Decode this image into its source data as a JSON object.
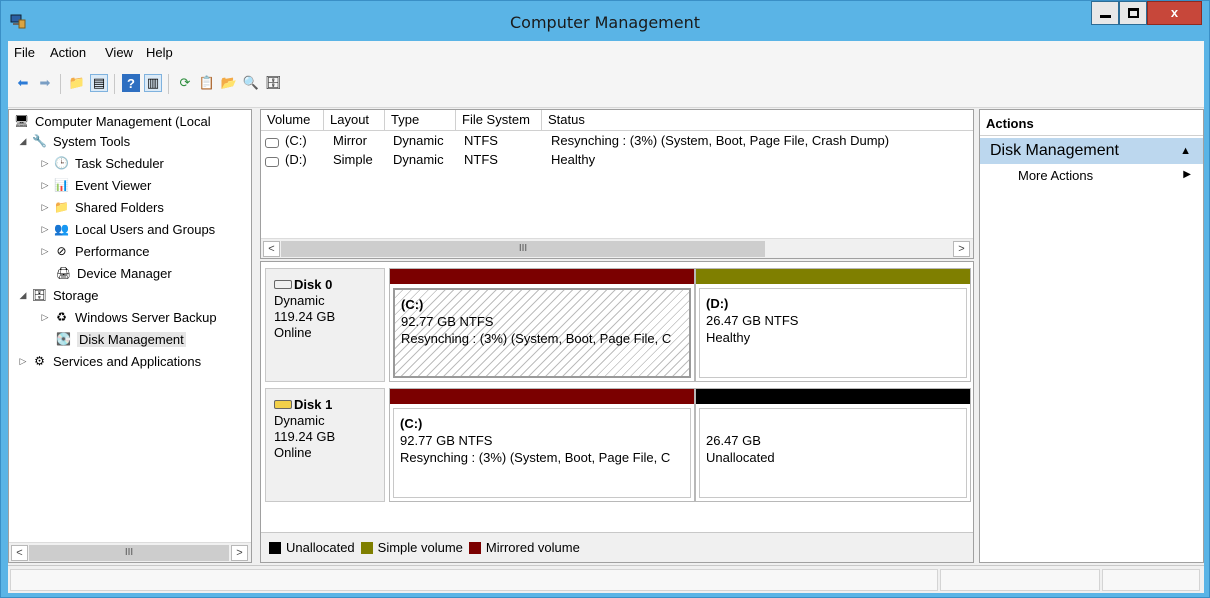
{
  "window": {
    "title": "Computer Management",
    "close_glyph": "x"
  },
  "menu": [
    "File",
    "Action",
    "View",
    "Help"
  ],
  "tree": {
    "root": "Computer Management (Local",
    "system_tools": "System Tools",
    "task_scheduler": "Task Scheduler",
    "event_viewer": "Event Viewer",
    "shared_folders": "Shared Folders",
    "local_users": "Local Users and Groups",
    "performance": "Performance",
    "device_manager": "Device Manager",
    "storage": "Storage",
    "wsb": "Windows Server Backup",
    "disk_mgmt": "Disk Management",
    "services": "Services and Applications",
    "scroll_thumb": "III"
  },
  "volumes": {
    "columns": [
      "Volume",
      "Layout",
      "Type",
      "File System",
      "Status"
    ],
    "rows": [
      [
        "(C:)",
        "Mirror",
        "Dynamic",
        "NTFS",
        "Resynching : (3%) (System, Boot, Page File, Crash Dump)"
      ],
      [
        "(D:)",
        "Simple",
        "Dynamic",
        "NTFS",
        "Healthy"
      ]
    ],
    "scroll_thumb": "III"
  },
  "disks": [
    {
      "name": "Disk 0",
      "type": "Dynamic",
      "size": "119.24 GB",
      "state": "Online",
      "parts": [
        {
          "name": "(C:)",
          "size": "92.77 GB NTFS",
          "status": "Resynching : (3%) (System, Boot, Page File, C"
        },
        {
          "name": "(D:)",
          "size": "26.47 GB NTFS",
          "status": "Healthy"
        }
      ]
    },
    {
      "name": "Disk 1",
      "type": "Dynamic",
      "size": "119.24 GB",
      "state": "Online",
      "parts": [
        {
          "name": "(C:)",
          "size": "92.77 GB NTFS",
          "status": "Resynching : (3%) (System, Boot, Page File, C"
        },
        {
          "name": "",
          "size": "26.47 GB",
          "status": "Unallocated"
        }
      ]
    }
  ],
  "legend": {
    "unallocated": "Unallocated",
    "simple": "Simple volume",
    "mirrored": "Mirrored volume"
  },
  "colors": {
    "mirrored": "#7b0000",
    "simple": "#7f7f00",
    "unallocated": "#000000",
    "titlebar": "#5ab4e6",
    "action_group": "#bcd7ee"
  },
  "actions": {
    "header": "Actions",
    "group": "Disk Management",
    "more": "More Actions"
  }
}
